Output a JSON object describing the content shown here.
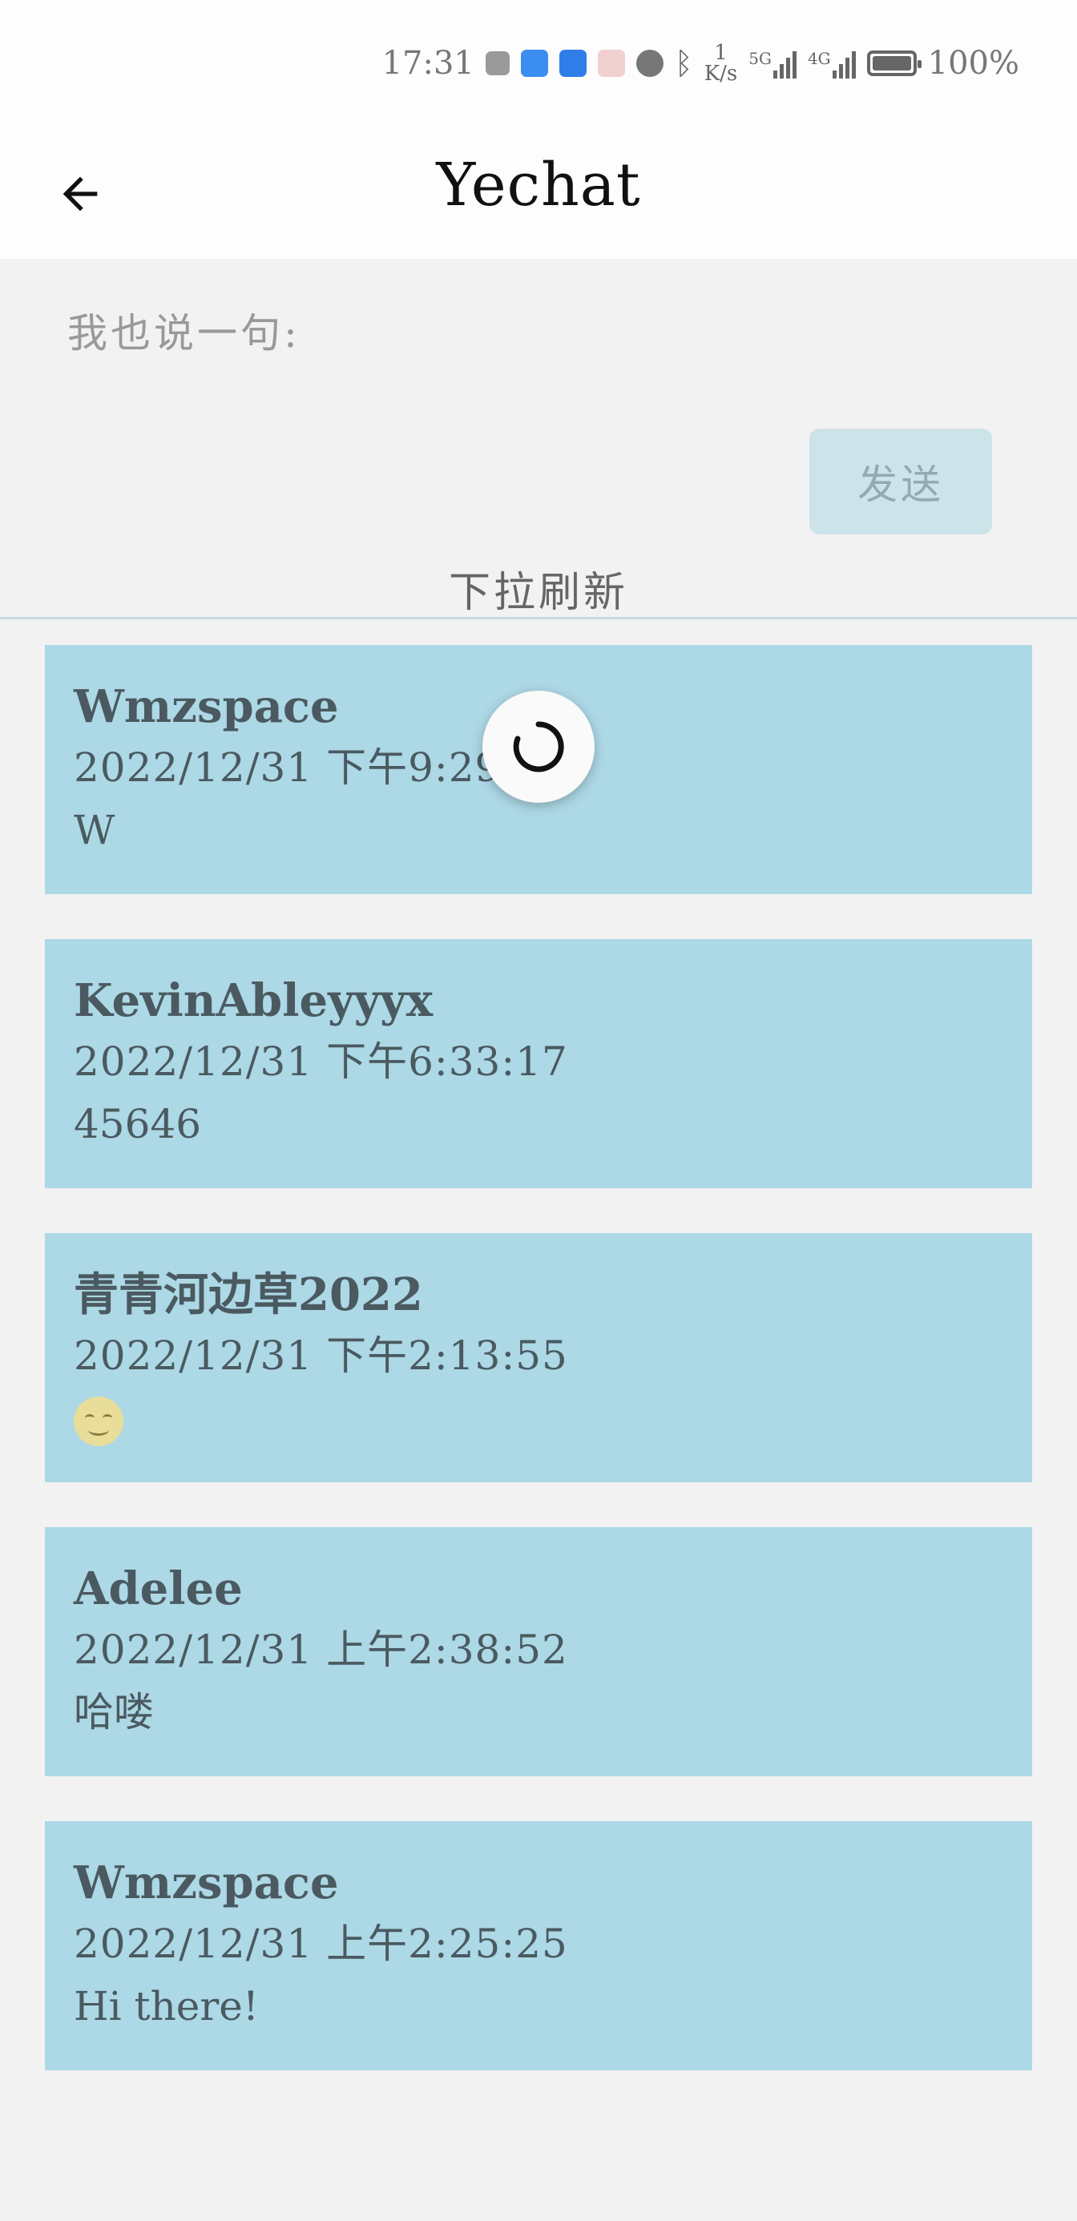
{
  "status_bar": {
    "time": "17:31",
    "net_speed_value": "1",
    "net_speed_unit": "K/s",
    "sig1_label": "5G",
    "sig2_label": "4G",
    "battery": "100%"
  },
  "app_bar": {
    "title": "Yechat",
    "back_icon": "arrow-left-icon"
  },
  "composer": {
    "placeholder": "我也说一句:",
    "value": "",
    "send_label": "发送"
  },
  "pull_hint": "下拉刷新",
  "messages": [
    {
      "name": "Wmzspace",
      "time": "2022/12/31  下午9:29:",
      "text": "W"
    },
    {
      "name": "KevinAbleyyyx",
      "time": "2022/12/31  下午6:33:17",
      "text": "45646"
    },
    {
      "name": "青青河边草2022",
      "time": "2022/12/31  下午2:13:55",
      "text": "",
      "emoji": "smiling-face-icon"
    },
    {
      "name": "Adelee",
      "time": "2022/12/31  上午2:38:52",
      "text": "哈喽"
    },
    {
      "name": "Wmzspace",
      "time": "2022/12/31  上午2:25:25",
      "text": "Hi  there!"
    }
  ],
  "colors": {
    "card_bg": "#add8e6",
    "page_bg": "#f2f2f2",
    "send_bg": "#cde3ea"
  }
}
